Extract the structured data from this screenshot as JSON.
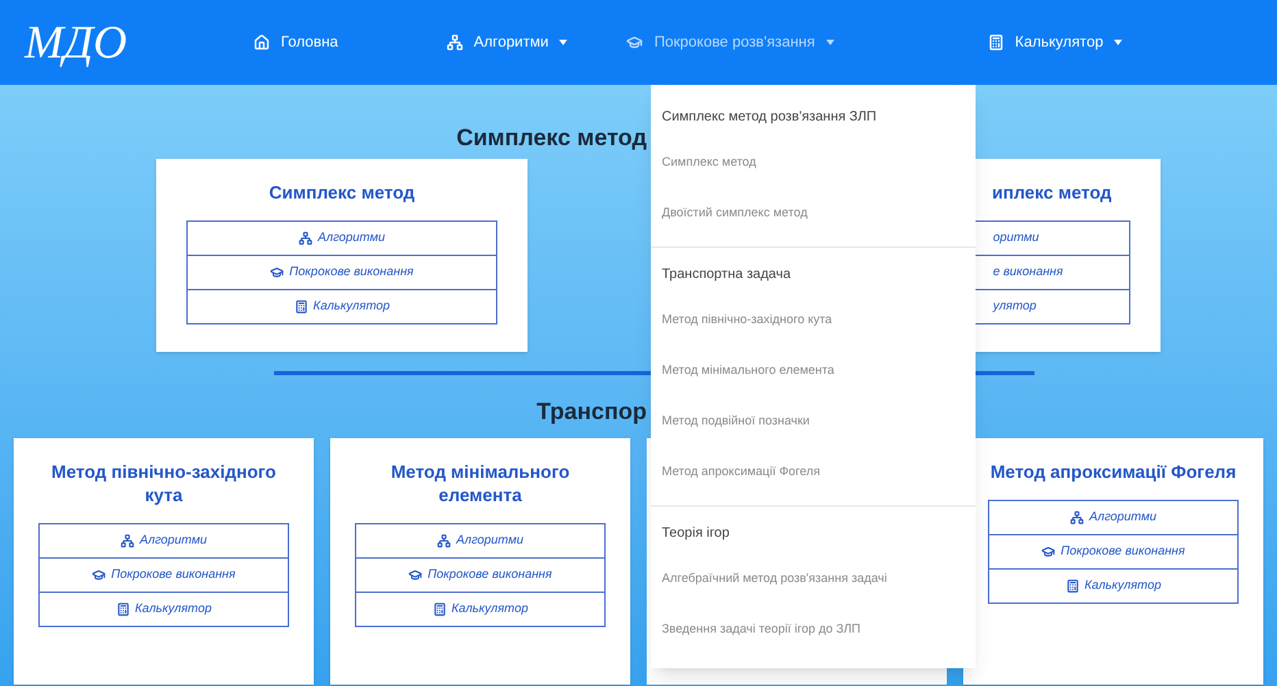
{
  "navbar": {
    "logo": "МДО",
    "items": [
      {
        "label": "Головна",
        "caret": false,
        "expanded": false
      },
      {
        "label": "Алгоритми",
        "caret": true,
        "expanded": false
      },
      {
        "label": "Покрокове розв'язання",
        "caret": true,
        "expanded": true
      },
      {
        "label": "Калькулятор",
        "caret": true,
        "expanded": false
      }
    ]
  },
  "sections": [
    {
      "title": "Симплекс метод",
      "cards": [
        {
          "kind": "card",
          "title": "Симплекс метод",
          "buttons": [
            "Алгоритми",
            "Покрокове виконання",
            "Калькулятор"
          ]
        },
        {
          "kind": "card",
          "title": "иплекс метод",
          "buttons": [
            "оритми",
            "е виконання",
            "улятор"
          ]
        }
      ]
    },
    {
      "title": "Транспор",
      "cards": [
        {
          "kind": "card",
          "title": "Метод північно-західного кута",
          "buttons": [
            "Алгоритми",
            "Покрокове виконання",
            "Калькулятор"
          ]
        },
        {
          "kind": "card",
          "title": "Метод мінімального елемента",
          "buttons": [
            "Алгоритми",
            "Покрокове виконання",
            "Калькулятор"
          ]
        },
        {
          "kind": "covered"
        },
        {
          "kind": "card",
          "title": "Метод апроксимації Фогеля",
          "buttons": [
            "Алгоритми",
            "Покрокове виконання",
            "Калькулятор"
          ]
        }
      ]
    }
  ],
  "dropdown": {
    "groups": [
      {
        "header": "Симплекс метод розв'язання ЗЛП",
        "items": [
          "Симплекс метод",
          "Двоїстий симплекс метод"
        ]
      },
      {
        "header": "Транспортна задача",
        "items": [
          "Метод північно-західного кута",
          "Метод мінімального елемента",
          "Метод подвійної позначки",
          "Метод апроксимації Фогеля"
        ]
      },
      {
        "header": "Теорія ігор",
        "items": [
          "Алгебраїчний метод розв'язання задачі",
          "Зведення задачі теорії ігор до ЗЛП"
        ]
      }
    ]
  }
}
